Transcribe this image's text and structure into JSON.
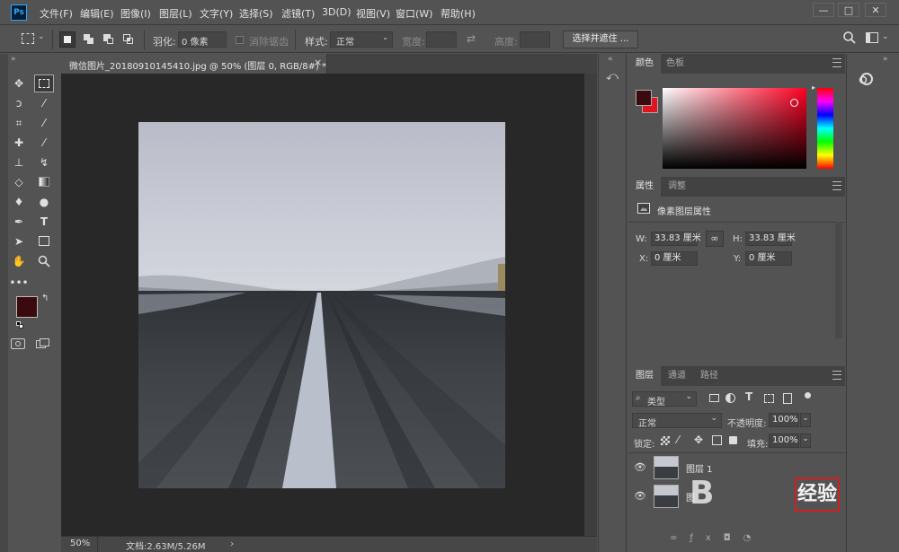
{
  "app": {
    "logo": "Ps"
  },
  "menu": [
    "文件(F)",
    "编辑(E)",
    "图像(I)",
    "图层(L)",
    "文字(Y)",
    "选择(S)",
    "滤镜(T)",
    "3D(D)",
    "视图(V)",
    "窗口(W)",
    "帮助(H)"
  ],
  "window_controls": [
    "—",
    "□",
    "✕"
  ],
  "options": {
    "feather_label": "羽化:",
    "feather_value": "0 像素",
    "antialias_label": "消除锯齿",
    "style_label": "样式:",
    "style_value": "正常",
    "width_label": "宽度:",
    "height_label": "高度:",
    "select_mask_button": "选择并遮住 ..."
  },
  "document": {
    "tab_title": "微信图片_20180910145410.jpg @ 50% (图层 0, RGB/8#) *",
    "close": "×",
    "zoom": "50%",
    "doc_info": "文档:2.63M/5.26M",
    "arrow": "›"
  },
  "color_panel": {
    "tabs": [
      "颜色",
      "色板"
    ],
    "foreground": "#3a0a0e",
    "background": "#e0141e"
  },
  "properties_panel": {
    "tabs": [
      "属性",
      "调整"
    ],
    "title": "像素图层属性",
    "w_label": "W:",
    "w_value": "33.83 厘米",
    "h_label": "H:",
    "h_value": "33.83 厘米",
    "x_label": "X:",
    "x_value": "0 厘米",
    "y_label": "Y:",
    "y_value": "0 厘米"
  },
  "layers_panel": {
    "tabs": [
      "图层",
      "通道",
      "路径"
    ],
    "filter_kind": "类型",
    "blend_mode": "正常",
    "opacity_label": "不透明度:",
    "opacity_value": "100%",
    "lock_label": "锁定:",
    "fill_label": "填充:",
    "fill_value": "100%",
    "layers": [
      {
        "name": "图层 1"
      },
      {
        "name": "图"
      }
    ]
  },
  "watermark": {
    "text": "经验"
  }
}
